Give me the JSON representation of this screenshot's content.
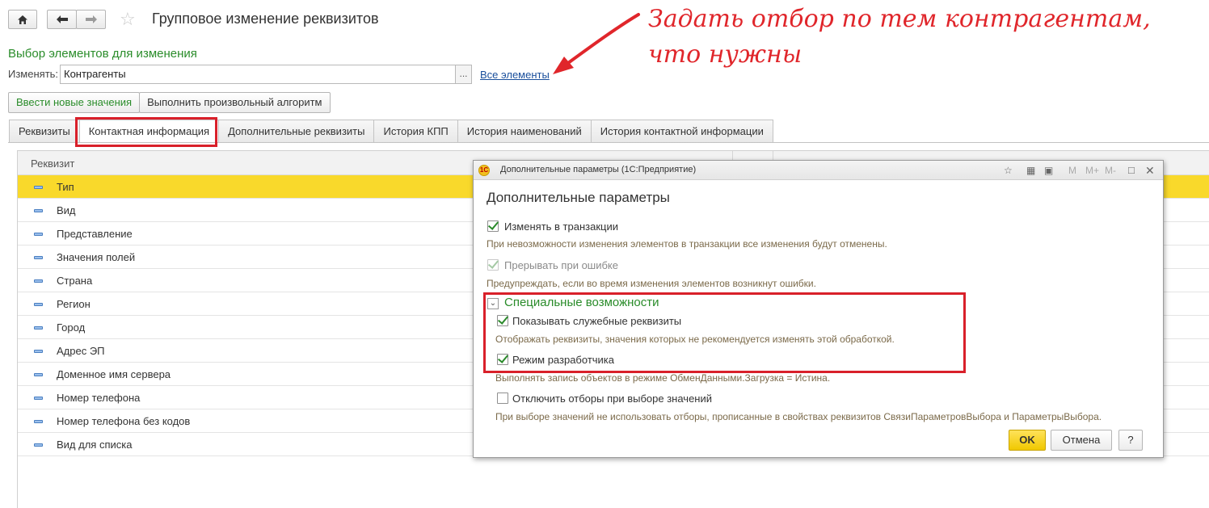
{
  "header": {
    "title": "Групповое изменение реквизитов"
  },
  "selection": {
    "section_title": "Выбор элементов для изменения",
    "change_label": "Изменять:",
    "change_value": "Контрагенты",
    "select_button": "...",
    "all_elements_link": "Все элементы"
  },
  "annotation": {
    "text": "Задать отбор по тем контрагентам, что нужны",
    "color": "#e0262b"
  },
  "actions": {
    "enter_values": "Ввести новые значения",
    "run_algorithm": "Выполнить произвольный алгоритм"
  },
  "tabs": [
    {
      "label": "Реквизиты"
    },
    {
      "label": "Контактная информация"
    },
    {
      "label": "Дополнительные реквизиты"
    },
    {
      "label": "История КПП"
    },
    {
      "label": "История наименований"
    },
    {
      "label": "История контактной информации"
    }
  ],
  "grid": {
    "header": "Реквизит",
    "rows": [
      {
        "label": "Тип"
      },
      {
        "label": "Вид"
      },
      {
        "label": "Представление"
      },
      {
        "label": "Значения полей"
      },
      {
        "label": "Страна"
      },
      {
        "label": "Регион"
      },
      {
        "label": "Город"
      },
      {
        "label": "Адрес ЭП"
      },
      {
        "label": "Доменное имя сервера"
      },
      {
        "label": "Номер телефона"
      },
      {
        "label": "Номер телефона без кодов"
      },
      {
        "label": "Вид для списка"
      }
    ]
  },
  "dialog": {
    "window_title": "Дополнительные параметры  (1С:Предприятие)",
    "toolbar": {
      "m": "M",
      "m_plus": "M+",
      "m_minus": "M-"
    },
    "heading": "Дополнительные параметры",
    "opt_transaction": "Изменять в транзакции",
    "hint_transaction": "При невозможности изменения элементов в транзакции все изменения будут отменены.",
    "opt_abort": "Прерывать при ошибке",
    "hint_abort": "Предупреждать, если во время изменения элементов возникнут ошибки.",
    "group_title": "Специальные возможности",
    "opt_service": "Показывать служебные реквизиты",
    "hint_service": "Отображать реквизиты, значения которых не рекомендуется изменять этой обработкой.",
    "opt_dev": "Режим разработчика",
    "hint_dev": "Выполнять запись объектов в режиме ОбменДанными.Загрузка = Истина.",
    "opt_filters": "Отключить отборы при выборе значений",
    "hint_filters": "При выборе значений не использовать отборы, прописанные в свойствах реквизитов СвязиПараметровВыбора и ПараметрыВыбора.",
    "ok": "OK",
    "cancel": "Отмена",
    "help": "?"
  },
  "colors": {
    "accent_green": "#2a8c2a",
    "selection_yellow": "#f9d92b",
    "highlight_red": "#d9202a"
  }
}
